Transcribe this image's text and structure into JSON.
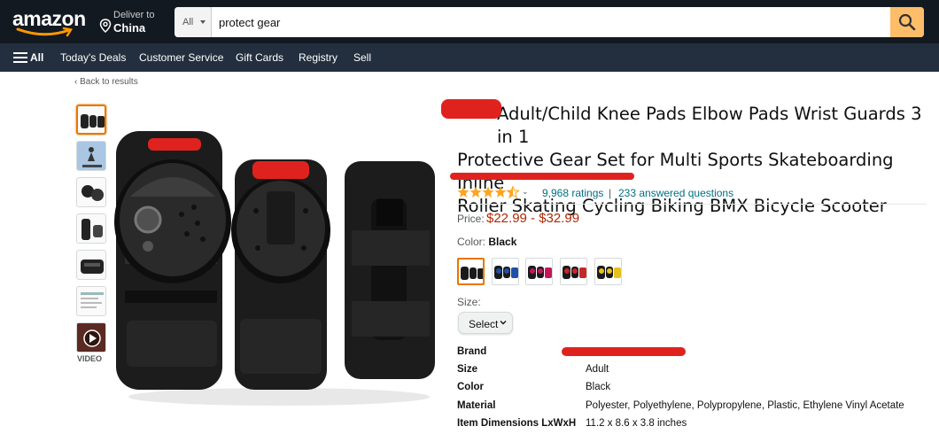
{
  "nav": {
    "logo_text": "amazon",
    "deliver_line1": "Deliver to",
    "deliver_line2": "China",
    "search_category": "All",
    "search_value": "protect gear",
    "all_label": "All",
    "links": [
      "Today's Deals",
      "Customer Service",
      "Gift Cards",
      "Registry",
      "Sell"
    ]
  },
  "breadcrumb": "‹ Back to results",
  "gallery": {
    "video_label": "VIDEO",
    "thumb_count": 7
  },
  "product": {
    "title_lines": [
      "Adult/Child Knee Pads Elbow Pads Wrist Guards 3 in 1",
      "Protective Gear Set for Multi Sports Skateboarding Inline",
      "Roller Skating Cycling Biking BMX Bicycle Scooter"
    ],
    "rating": 4.5,
    "ratings_count": "9,968 ratings",
    "separator": "|",
    "answered": "233 answered questions",
    "price_label": "Price:",
    "price_value": "$22.99 - $32.99",
    "color_label": "Color:",
    "color_value": "Black",
    "swatch_colors": [
      "#1a1a1a",
      "#1f4fa8",
      "#c2185b",
      "#c62828",
      "#e6c11a"
    ],
    "size_label": "Size:",
    "size_select": "Select",
    "specs": [
      {
        "k": "Brand",
        "v": ""
      },
      {
        "k": "Size",
        "v": "Adult"
      },
      {
        "k": "Color",
        "v": "Black"
      },
      {
        "k": "Material",
        "v": "Polyester, Polyethylene, Polypropylene, Plastic, Ethylene Vinyl Acetate"
      },
      {
        "k": "Item Dimensions LxWxH",
        "v": "11.2 x 8.6 x 3.8 inches"
      }
    ]
  },
  "colors": {
    "nav_dark": "#131921",
    "nav_sub": "#232f3e",
    "search_button": "#febd69",
    "link": "#007185",
    "price": "#b12704",
    "star": "#ffa41c",
    "active_border": "#e77600",
    "redaction": "#e0221f"
  }
}
